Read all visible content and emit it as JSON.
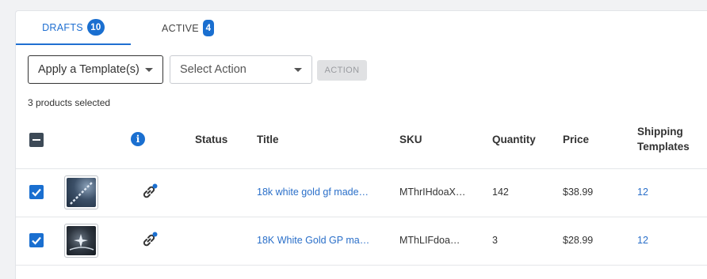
{
  "tabs": [
    {
      "label": "DRAFTS",
      "count": "10"
    },
    {
      "label": "ACTIVE",
      "count": "4"
    }
  ],
  "toolbar": {
    "template_select": "Apply a Template(s)",
    "action_select": "Select Action",
    "action_button": "ACTION"
  },
  "selection": "3 products selected",
  "table": {
    "headers": {
      "status": "Status",
      "title": "Title",
      "sku": "SKU",
      "quantity": "Quantity",
      "price": "Price",
      "shipping_line1": "Shipping",
      "shipping_line2": "Templates"
    },
    "info_symbol": "i",
    "rows": [
      {
        "title": "18k white gold gf made…",
        "sku": "MThrIHdoaX…",
        "quantity": "142",
        "price": "$38.99",
        "shipping": "12",
        "checked": true
      },
      {
        "title": "18K White Gold GP ma…",
        "sku": "MThLIFdoa…",
        "quantity": "3",
        "price": "$28.99",
        "shipping": "12",
        "checked": true
      }
    ]
  },
  "colors": {
    "accent": "#1a6fd0",
    "link": "#2a6fc9",
    "disabled": "#e0e1e3"
  }
}
